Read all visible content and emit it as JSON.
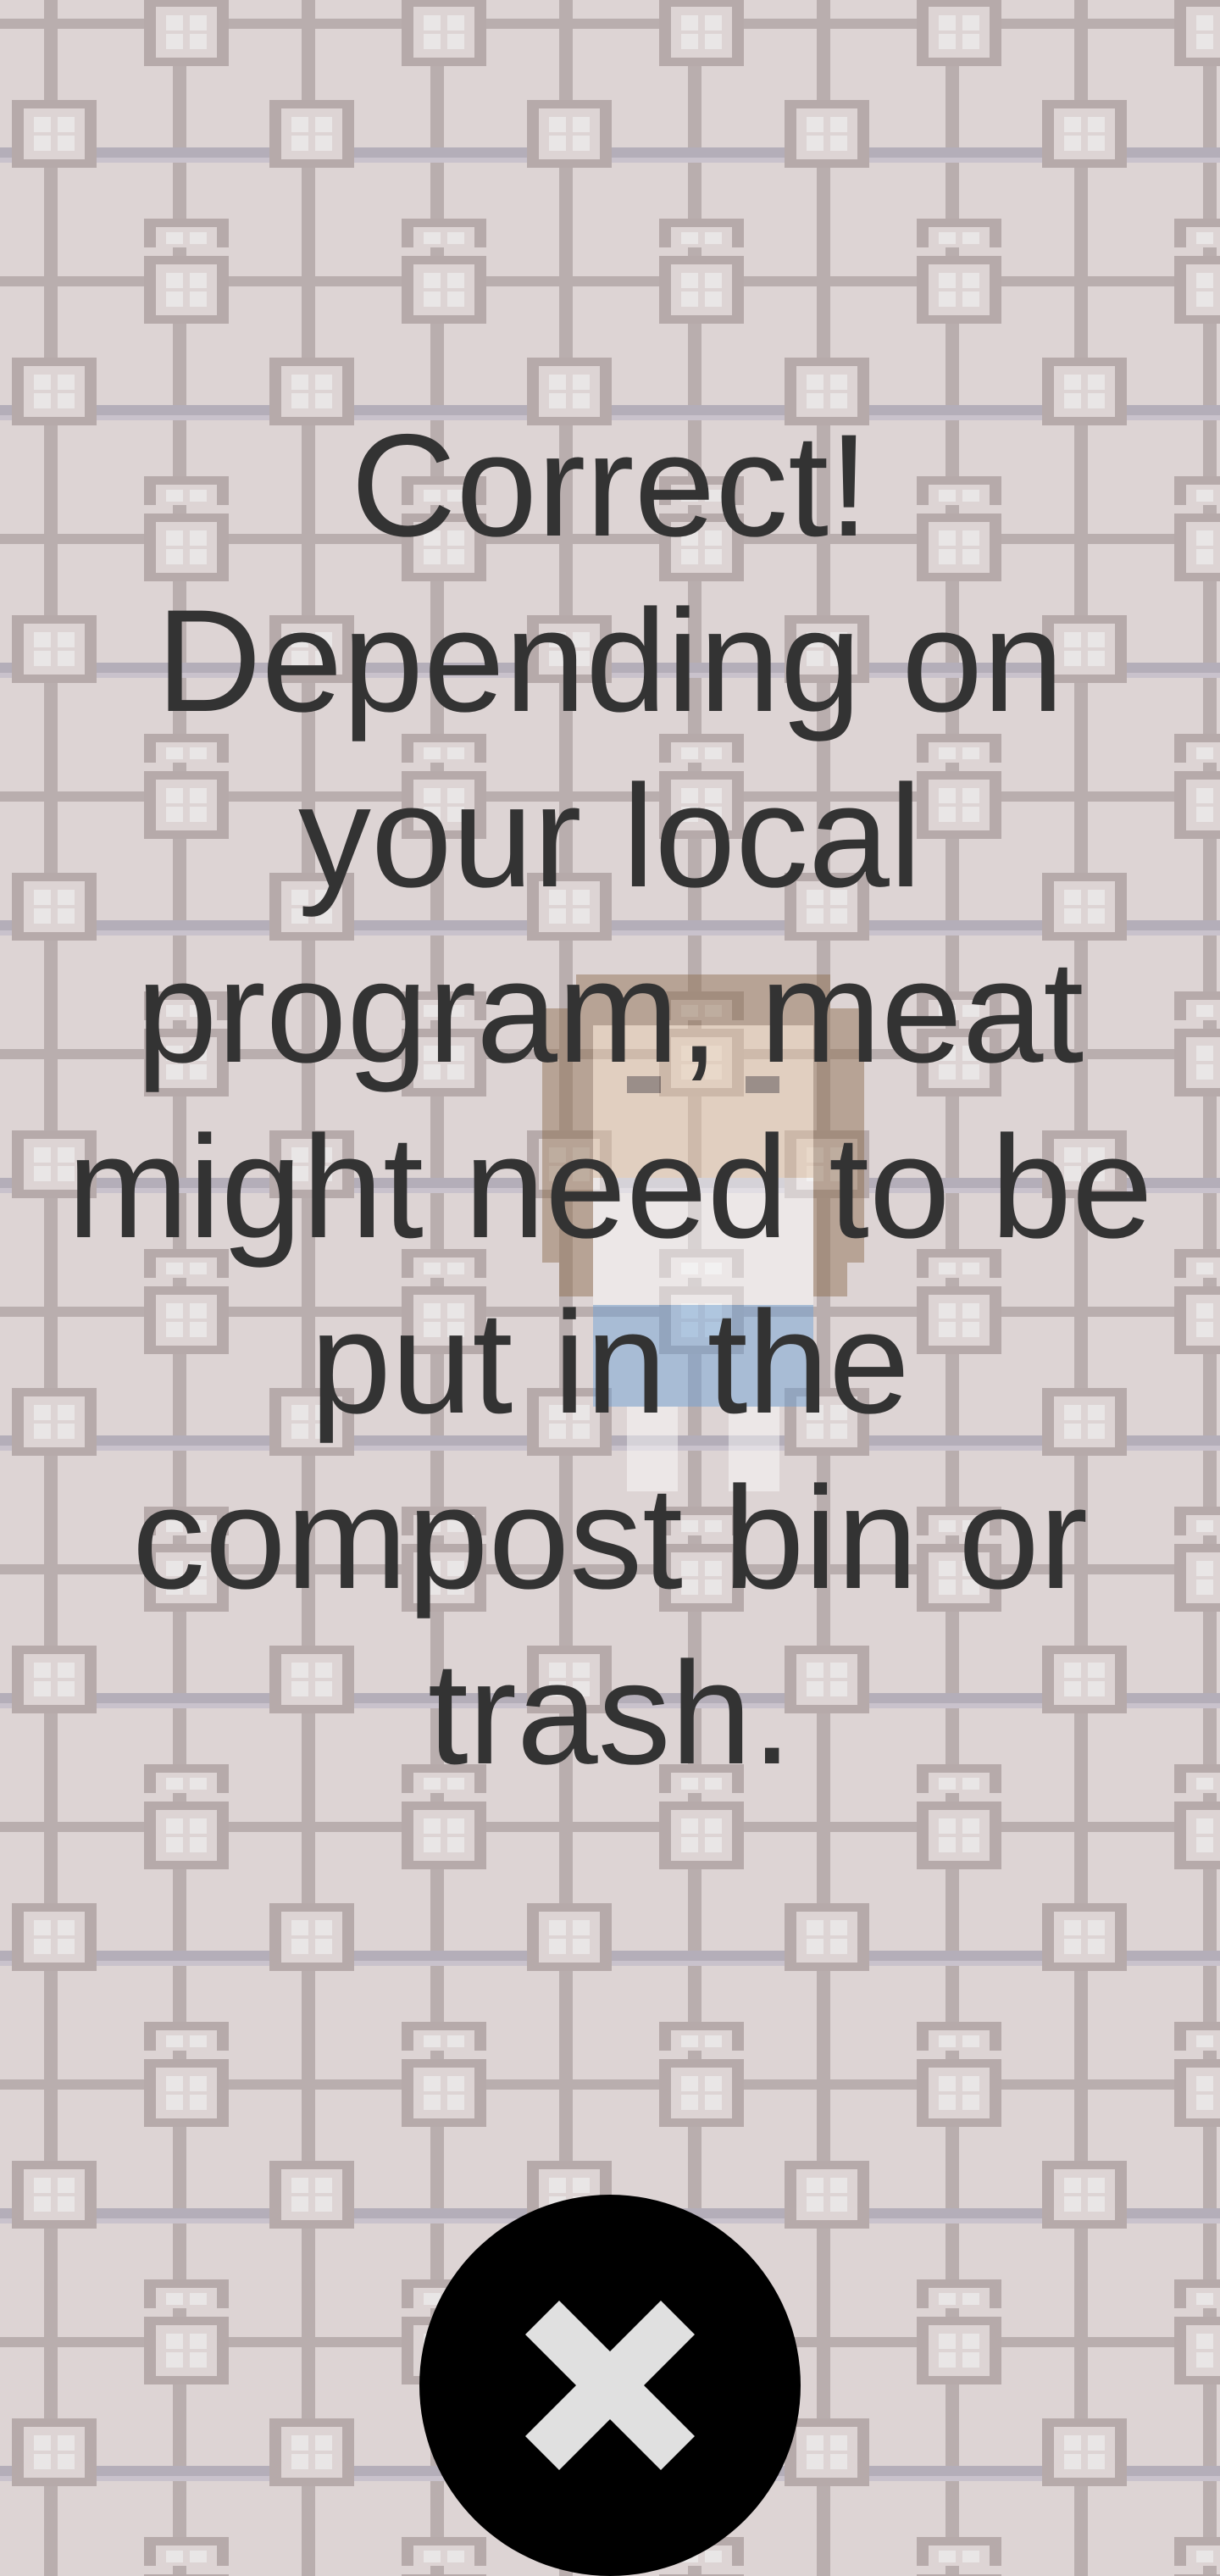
{
  "game": {
    "feedback_message": "Correct! Depending on your local program, meat might need to be put in the compost bin or trash.",
    "close_icon": "close-icon",
    "character_icon": "pixel-character"
  },
  "colors": {
    "tile_background": "#ddd4d4",
    "text": "#333333",
    "close_button": "#000000",
    "close_icon": "#e0e0e0"
  }
}
